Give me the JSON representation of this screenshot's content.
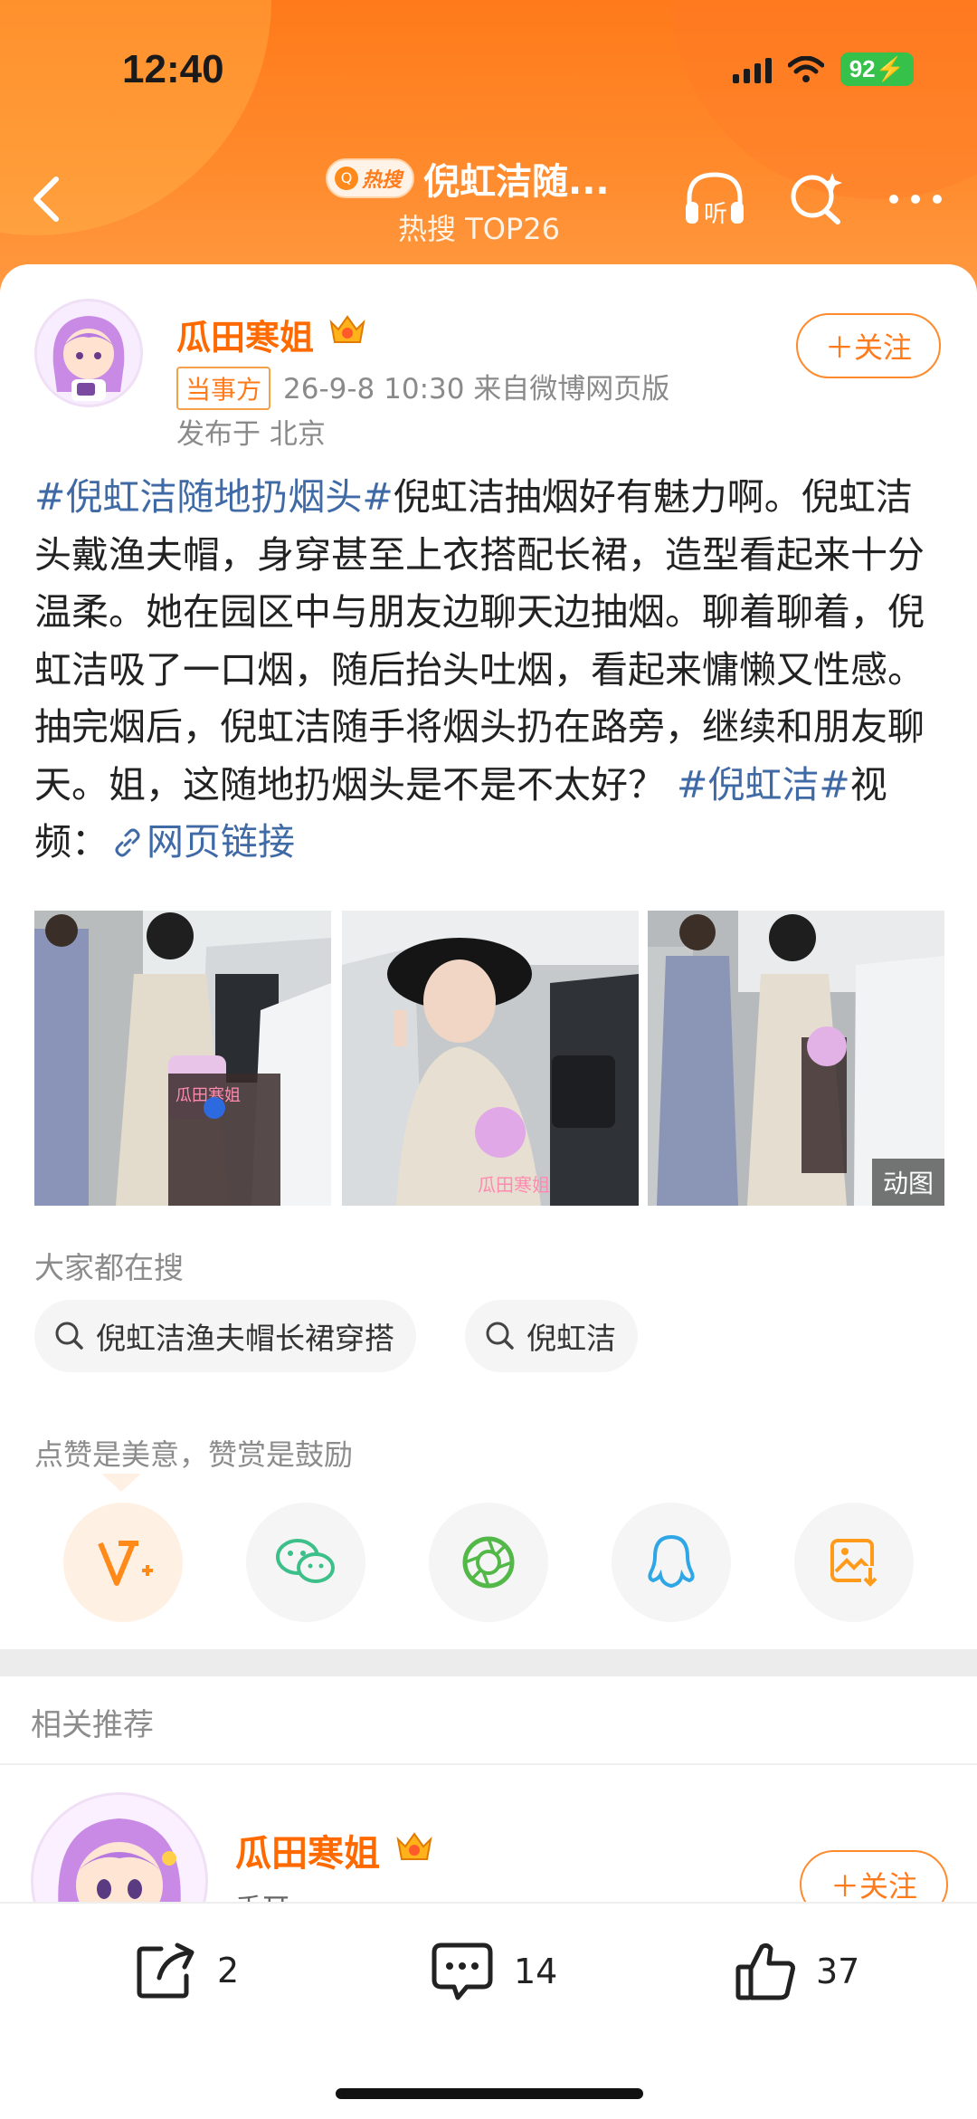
{
  "status_bar": {
    "time": "12:40",
    "battery": "92"
  },
  "header": {
    "hot_badge": "热搜",
    "title": "倪虹洁随...",
    "subtitle": "热搜 TOP26",
    "icons": [
      "back-arrow-icon",
      "headphones-listen-icon",
      "search-sparkle-icon",
      "more-icon"
    ],
    "listen_label": "听"
  },
  "post": {
    "author": "瓜田寒姐",
    "author_tag": "当事方",
    "meta": "26-9-8 10:30  来自微博网页版",
    "location": "发布于 北京",
    "follow_label": "＋关注",
    "body": {
      "topic1": "#倪虹洁随地扔烟头#",
      "text1": "倪虹洁抽烟好有魅力啊。倪虹洁头戴渔夫帽，身穿甚至上衣搭配长裙，造型看起来十分温柔。她在园区中与朋友边聊天边抽烟。聊着聊着，倪虹洁吸了一口烟，随后抬头吐烟，看起来慵懒又性感。抽完烟后，倪虹洁随手将烟头扔在路旁，继续和朋友聊天。姐，这随地扔烟头是不是不太好？",
      "topic2": "#倪虹洁#",
      "text2": "视频：",
      "link": "网页链接"
    },
    "photo_overlay_text": "瓜田寒姐",
    "gif_badge": "动图"
  },
  "searches": {
    "label": "大家都在搜",
    "chips": [
      "倪虹洁渔夫帽长裙穿搭",
      "倪虹洁"
    ]
  },
  "reward": {
    "label": "点赞是美意，赞赏是鼓励",
    "share_targets": [
      "vplus-reward-icon",
      "wechat-icon",
      "moments-icon",
      "qq-icon",
      "save-image-icon"
    ]
  },
  "recommend": {
    "label": "相关推荐",
    "author": "瓜田寒姐",
    "sub": "手耳",
    "follow_label": "＋关注"
  },
  "bottom_bar": {
    "repost_count": "2",
    "comment_count": "14",
    "like_count": "37"
  },
  "colors": {
    "accent": "#ff7a1a",
    "topic": "#3f6aa6",
    "author": "#ff6a00"
  }
}
